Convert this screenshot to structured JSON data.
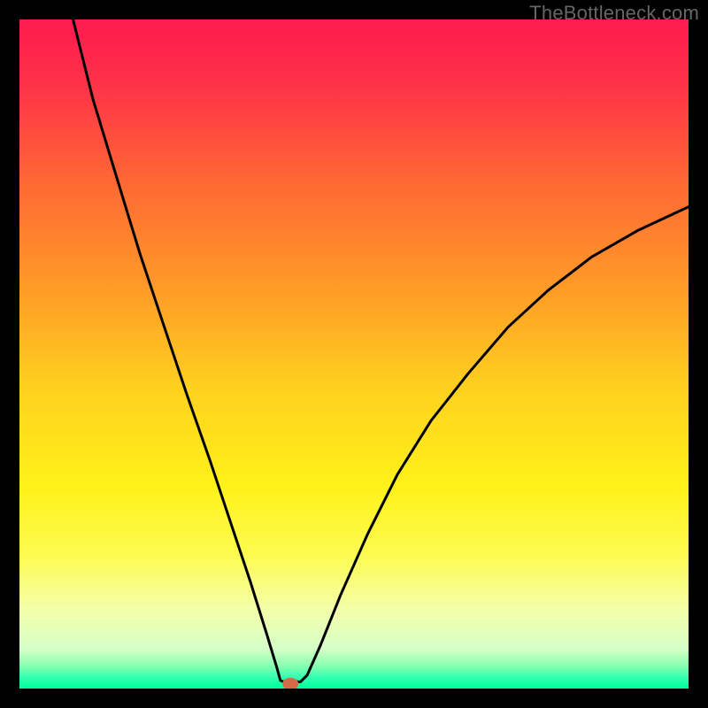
{
  "watermark": "TheBottleneck.com",
  "gradient": {
    "stops": [
      {
        "offset": 0.0,
        "color": "#ff1a4f"
      },
      {
        "offset": 0.1,
        "color": "#ff3348"
      },
      {
        "offset": 0.25,
        "color": "#ff6a33"
      },
      {
        "offset": 0.4,
        "color": "#ff9a28"
      },
      {
        "offset": 0.55,
        "color": "#ffd01e"
      },
      {
        "offset": 0.7,
        "color": "#fff21a"
      },
      {
        "offset": 0.8,
        "color": "#fdfb50"
      },
      {
        "offset": 0.88,
        "color": "#f4ffa8"
      },
      {
        "offset": 0.94,
        "color": "#d6ffc8"
      },
      {
        "offset": 0.965,
        "color": "#8cffb0"
      },
      {
        "offset": 0.985,
        "color": "#2cffb0"
      },
      {
        "offset": 1.0,
        "color": "#00ff9c"
      }
    ]
  },
  "marker": {
    "x_frac": 0.405,
    "y_frac": 0.993,
    "color": "#d46a4a",
    "rx": 9,
    "ry": 7
  },
  "chart_data": {
    "type": "line",
    "title": "",
    "xlabel": "",
    "ylabel": "",
    "xlim": [
      0,
      1
    ],
    "ylim": [
      0,
      1
    ],
    "description": "Absolute-value-style bottleneck curve with minimum near x≈0.40; left branch reaches y≈1.0 at x≈0.08, right branch reaches y≈0.72 at x=1.0. Background is a vertical red→orange→yellow→green gradient.",
    "series": [
      {
        "name": "curve",
        "points": [
          {
            "x": 0.08,
            "y": 1.0
          },
          {
            "x": 0.11,
            "y": 0.88
          },
          {
            "x": 0.145,
            "y": 0.765
          },
          {
            "x": 0.18,
            "y": 0.65
          },
          {
            "x": 0.215,
            "y": 0.545
          },
          {
            "x": 0.25,
            "y": 0.44
          },
          {
            "x": 0.285,
            "y": 0.34
          },
          {
            "x": 0.315,
            "y": 0.25
          },
          {
            "x": 0.345,
            "y": 0.16
          },
          {
            "x": 0.37,
            "y": 0.08
          },
          {
            "x": 0.385,
            "y": 0.03
          },
          {
            "x": 0.39,
            "y": 0.012
          },
          {
            "x": 0.395,
            "y": 0.01
          },
          {
            "x": 0.42,
            "y": 0.01
          },
          {
            "x": 0.43,
            "y": 0.02
          },
          {
            "x": 0.45,
            "y": 0.065
          },
          {
            "x": 0.48,
            "y": 0.14
          },
          {
            "x": 0.52,
            "y": 0.23
          },
          {
            "x": 0.565,
            "y": 0.32
          },
          {
            "x": 0.615,
            "y": 0.4
          },
          {
            "x": 0.67,
            "y": 0.47
          },
          {
            "x": 0.73,
            "y": 0.54
          },
          {
            "x": 0.79,
            "y": 0.595
          },
          {
            "x": 0.855,
            "y": 0.645
          },
          {
            "x": 0.925,
            "y": 0.685
          },
          {
            "x": 1.0,
            "y": 0.72
          }
        ]
      }
    ]
  }
}
